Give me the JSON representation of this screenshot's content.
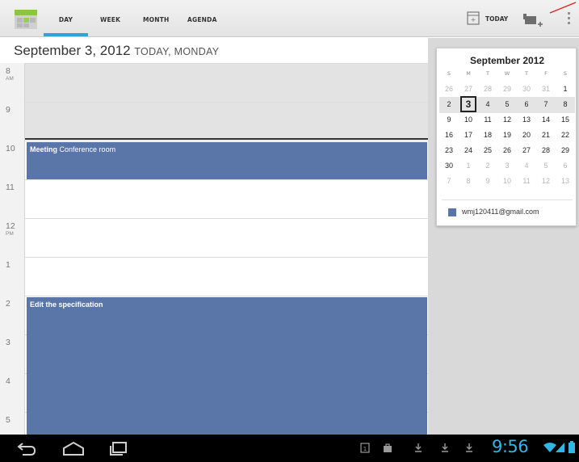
{
  "actionbar": {
    "tabs": [
      {
        "label": "DAY",
        "selected": true
      },
      {
        "label": "WEEK",
        "selected": false
      },
      {
        "label": "MONTH",
        "selected": false
      },
      {
        "label": "AGENDA",
        "selected": false
      }
    ],
    "today_label": "TODAY",
    "icons": [
      "calendar-app-icon",
      "today-calendar-icon",
      "new-event-icon",
      "overflow-menu-icon"
    ],
    "accent_color": "#33a3d6"
  },
  "header": {
    "date": "September 3, 2012",
    "subtitle": "TODAY, MONDAY"
  },
  "day_view": {
    "hours": [
      {
        "label": "8",
        "ampm": "AM"
      },
      {
        "label": "9",
        "ampm": ""
      },
      {
        "label": "10",
        "ampm": ""
      },
      {
        "label": "11",
        "ampm": ""
      },
      {
        "label": "12",
        "ampm": "PM"
      },
      {
        "label": "1",
        "ampm": ""
      },
      {
        "label": "2",
        "ampm": ""
      },
      {
        "label": "3",
        "ampm": ""
      },
      {
        "label": "4",
        "ampm": ""
      },
      {
        "label": "5",
        "ampm": ""
      }
    ],
    "events": [
      {
        "title": "Meeting",
        "location": "Conference room"
      },
      {
        "title": "Edit the specification",
        "location": ""
      }
    ],
    "event_color": "#5a75a8"
  },
  "mini_calendar": {
    "title": "September 2012",
    "weekdays": [
      "S",
      "M",
      "T",
      "W",
      "T",
      "F",
      "S"
    ],
    "weeks": [
      [
        {
          "d": "26",
          "o": true
        },
        {
          "d": "27",
          "o": true
        },
        {
          "d": "28",
          "o": true
        },
        {
          "d": "29",
          "o": true
        },
        {
          "d": "30",
          "o": true
        },
        {
          "d": "31",
          "o": true
        },
        {
          "d": "1",
          "o": false
        }
      ],
      [
        {
          "d": "2",
          "o": false
        },
        {
          "d": "3",
          "o": false,
          "today": true
        },
        {
          "d": "4",
          "o": false
        },
        {
          "d": "5",
          "o": false
        },
        {
          "d": "6",
          "o": false
        },
        {
          "d": "7",
          "o": false
        },
        {
          "d": "8",
          "o": false
        }
      ],
      [
        {
          "d": "9",
          "o": false
        },
        {
          "d": "10",
          "o": false
        },
        {
          "d": "11",
          "o": false
        },
        {
          "d": "12",
          "o": false
        },
        {
          "d": "13",
          "o": false
        },
        {
          "d": "14",
          "o": false
        },
        {
          "d": "15",
          "o": false
        }
      ],
      [
        {
          "d": "16",
          "o": false
        },
        {
          "d": "17",
          "o": false
        },
        {
          "d": "18",
          "o": false
        },
        {
          "d": "19",
          "o": false
        },
        {
          "d": "20",
          "o": false
        },
        {
          "d": "21",
          "o": false
        },
        {
          "d": "22",
          "o": false
        }
      ],
      [
        {
          "d": "23",
          "o": false
        },
        {
          "d": "24",
          "o": false
        },
        {
          "d": "25",
          "o": false
        },
        {
          "d": "26",
          "o": false
        },
        {
          "d": "27",
          "o": false
        },
        {
          "d": "28",
          "o": false
        },
        {
          "d": "29",
          "o": false
        }
      ],
      [
        {
          "d": "30",
          "o": false
        },
        {
          "d": "1",
          "o": true
        },
        {
          "d": "2",
          "o": true
        },
        {
          "d": "3",
          "o": true
        },
        {
          "d": "4",
          "o": true
        },
        {
          "d": "5",
          "o": true
        },
        {
          "d": "6",
          "o": true
        }
      ],
      [
        {
          "d": "7",
          "o": true
        },
        {
          "d": "8",
          "o": true
        },
        {
          "d": "9",
          "o": true
        },
        {
          "d": "10",
          "o": true
        },
        {
          "d": "11",
          "o": true
        },
        {
          "d": "12",
          "o": true
        },
        {
          "d": "13",
          "o": true
        }
      ]
    ],
    "account": {
      "email": "wmj120411@gmail.com",
      "color": "#5a75a8"
    }
  },
  "system_bar": {
    "time": "9:56",
    "nav": [
      "back-icon",
      "home-icon",
      "recent-apps-icon"
    ],
    "status_icons": [
      "calendar-notification-icon",
      "bag-notification-icon",
      "download-icon",
      "download-icon",
      "download-icon",
      "wifi-icon",
      "signal-icon",
      "battery-icon"
    ],
    "clock_color": "#33b5e5"
  }
}
